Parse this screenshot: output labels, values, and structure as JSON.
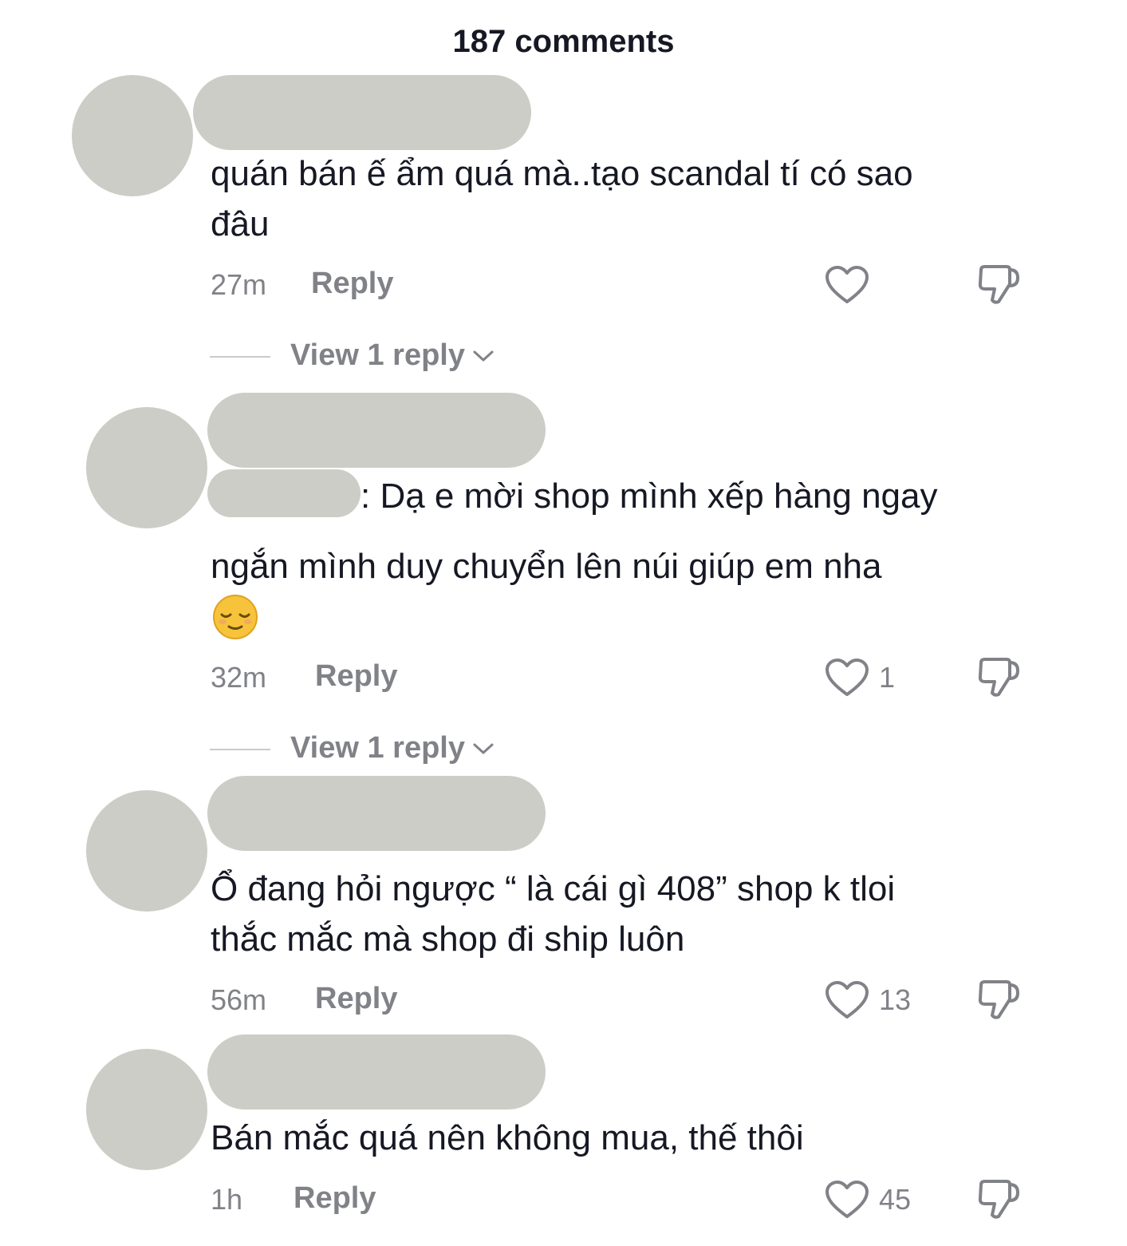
{
  "header": {
    "title": "187 comments"
  },
  "reply_label": "Reply",
  "view_replies_label": "View 1 reply",
  "comments": [
    {
      "text": "quán bán ế ẩm quá mà..tạo scandal tí có sao\nđâu",
      "time": "27m",
      "likes": ""
    },
    {
      "text_line1": ": Dạ e mời shop mình xếp hàng ngay",
      "text_line2": "ngắn mình duy chuyển lên núi giúp em nha",
      "emoji": "relieved-face-emoji",
      "time": "32m",
      "likes": "1"
    },
    {
      "text": "Ổ đang hỏi ngược “ là cái gì 408” shop k tloi\nthắc mắc mà shop đi ship luôn",
      "time": "56m",
      "likes": "13"
    },
    {
      "text": "Bán mắc quá nên không mua, thế thôi",
      "time": "1h",
      "likes": "45"
    }
  ],
  "colors": {
    "redaction": "#cccdc6",
    "text_primary": "#161823",
    "text_secondary": "#808287"
  }
}
